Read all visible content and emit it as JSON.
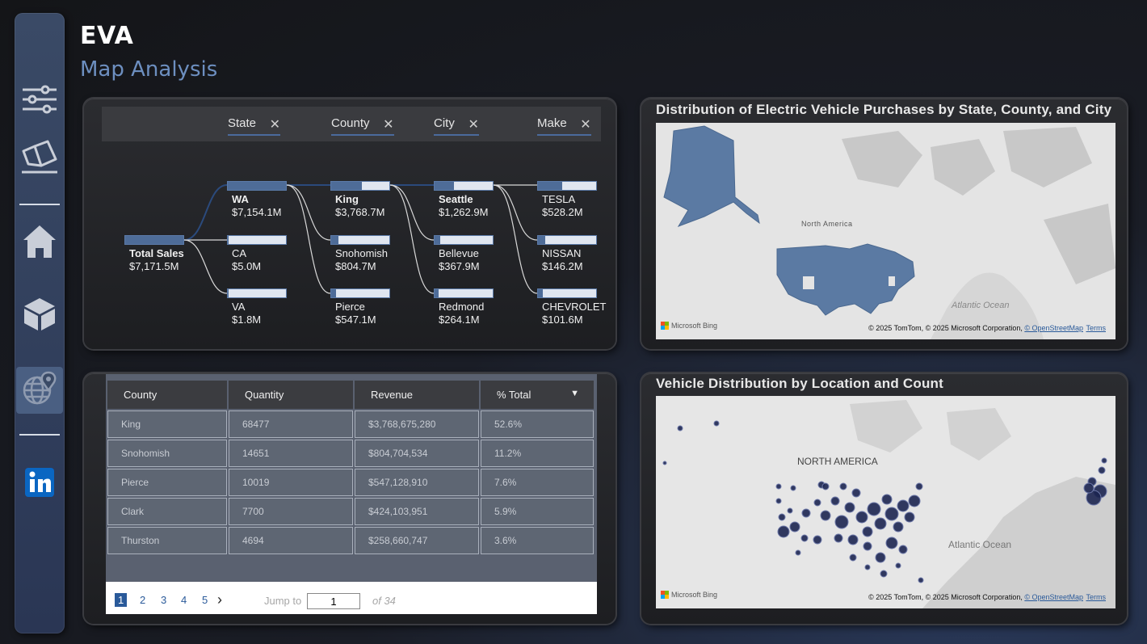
{
  "header": {
    "title": "EVA",
    "subtitle": "Map Analysis"
  },
  "sidebar": {
    "items": [
      {
        "icon": "filter-sliders-icon"
      },
      {
        "icon": "eraser-icon"
      },
      {
        "icon": "home-icon"
      },
      {
        "icon": "cube-icon"
      },
      {
        "icon": "globe-location-icon",
        "active": true
      },
      {
        "icon": "linkedin-icon"
      }
    ]
  },
  "tree": {
    "chips": [
      "State",
      "County",
      "City",
      "Make"
    ],
    "root": {
      "label": "Total Sales",
      "value": "$7,171.5M",
      "fill": 1.0
    },
    "levels": [
      [
        {
          "label": "WA",
          "value": "$7,154.1M",
          "bold": true,
          "fill": 1.0
        },
        {
          "label": "CA",
          "value": "$5.0M",
          "fill": 0.0
        },
        {
          "label": "VA",
          "value": "$1.8M",
          "fill": 0.0
        }
      ],
      [
        {
          "label": "King",
          "value": "$3,768.7M",
          "bold": true,
          "fill": 0.53
        },
        {
          "label": "Snohomish",
          "value": "$804.7M",
          "fill": 0.12
        },
        {
          "label": "Pierce",
          "value": "$547.1M",
          "fill": 0.08
        }
      ],
      [
        {
          "label": "Seattle",
          "value": "$1,262.9M",
          "bold": true,
          "fill": 0.34
        },
        {
          "label": "Bellevue",
          "value": "$367.9M",
          "fill": 0.1
        },
        {
          "label": "Redmond",
          "value": "$264.1M",
          "fill": 0.07
        }
      ],
      [
        {
          "label": "TESLA",
          "value": "$528.2M",
          "fill": 0.42
        },
        {
          "label": "NISSAN",
          "value": "$146.2M",
          "fill": 0.12
        },
        {
          "label": "CHEVROLET",
          "value": "$101.6M",
          "fill": 0.08
        }
      ]
    ]
  },
  "table": {
    "headers": [
      "County",
      "Quantity",
      "Revenue",
      "% Total"
    ],
    "sort_indicator": "▼",
    "rows": [
      [
        "King",
        "68477",
        "$3,768,675,280",
        "52.6%"
      ],
      [
        "Snohomish",
        "14651",
        "$804,704,534",
        "11.2%"
      ],
      [
        "Pierce",
        "10019",
        "$547,128,910",
        "7.6%"
      ],
      [
        "Clark",
        "7700",
        "$424,103,951",
        "5.9%"
      ],
      [
        "Thurston",
        "4694",
        "$258,660,747",
        "3.6%"
      ]
    ],
    "pager": {
      "pages": [
        "1",
        "2",
        "3",
        "4",
        "5"
      ],
      "current": "1",
      "next": "›",
      "jump_label": "Jump to",
      "jump_value": "1",
      "of_label": "of 34"
    }
  },
  "map1": {
    "title": "Distribution of Electric Vehicle Purchases by State, County, and City",
    "continent_label": "North America",
    "ocean_label": "Atlantic Ocean",
    "fill_color": "#5b7aa3",
    "bing": "Microsoft Bing",
    "copyright": "© 2025 TomTom, © 2025 Microsoft Corporation, ",
    "osm": "© OpenStreetMap",
    "terms": "Terms"
  },
  "map2": {
    "title": "Vehicle Distribution by Location and Count",
    "continent_label": "NORTH AMERICA",
    "ocean_label": "Atlantic Ocean",
    "bubble_color": "#1c2550",
    "bing": "Microsoft Bing",
    "copyright": "© 2025 TomTom, © 2025 Microsoft Corporation, ",
    "osm": "© OpenStreetMap",
    "terms": "Terms"
  }
}
